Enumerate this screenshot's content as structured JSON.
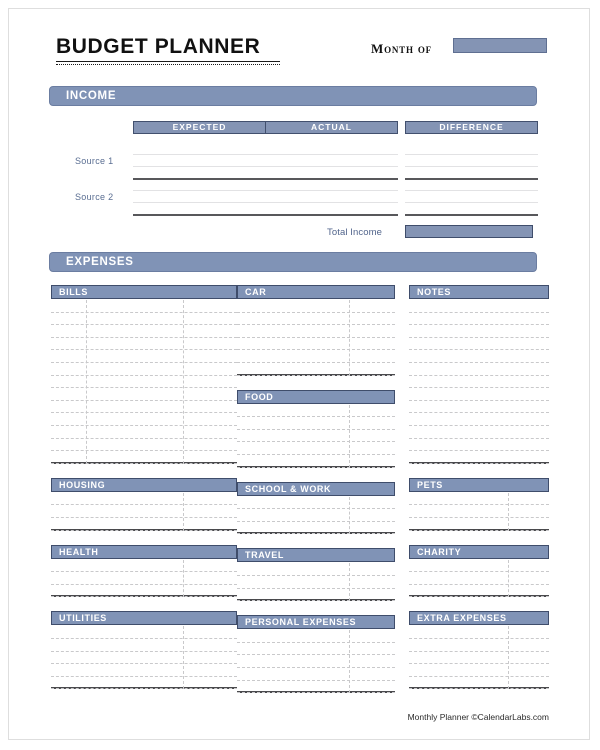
{
  "document": {
    "title": "BUDGET PLANNER",
    "month_label": "Month of",
    "month_value": ""
  },
  "income": {
    "banner": "INCOME",
    "columns": [
      "EXPECTED",
      "ACTUAL",
      "DIFFERENCE"
    ],
    "rows": [
      {
        "label": "Source 1"
      },
      {
        "label": "Source 2"
      }
    ],
    "total_label": "Total Income",
    "total_value": ""
  },
  "expenses": {
    "banner": "EXPENSES",
    "blocks": [
      {
        "title": "BILLS",
        "column": 0,
        "rows": 13,
        "dividers": 2
      },
      {
        "title": "HOUSING",
        "column": 0,
        "rows": 3,
        "dividers": 1
      },
      {
        "title": "HEALTH",
        "column": 0,
        "rows": 3,
        "dividers": 1
      },
      {
        "title": "UTILITIES",
        "column": 0,
        "rows": 5,
        "dividers": 1
      },
      {
        "title": "CAR",
        "column": 1,
        "rows": 6,
        "dividers": 1
      },
      {
        "title": "FOOD",
        "column": 1,
        "rows": 5,
        "dividers": 1
      },
      {
        "title": "SCHOOL & WORK",
        "column": 1,
        "rows": 3,
        "dividers": 1
      },
      {
        "title": "TRAVEL",
        "column": 1,
        "rows": 3,
        "dividers": 1
      },
      {
        "title": "PERSONAL EXPENSES",
        "column": 1,
        "rows": 5,
        "dividers": 1
      },
      {
        "title": "NOTES",
        "column": 2,
        "rows": 13,
        "dividers": 0
      },
      {
        "title": "PETS",
        "column": 2,
        "rows": 3,
        "dividers": 1
      },
      {
        "title": "CHARITY",
        "column": 2,
        "rows": 3,
        "dividers": 1
      },
      {
        "title": "EXTRA  EXPENSES",
        "column": 2,
        "rows": 5,
        "dividers": 1
      }
    ]
  },
  "footer": {
    "text": "Monthly Planner ©CalendarLabs.com"
  },
  "theme": {
    "banner_fill": "#8093b6",
    "banner_border": "#6b7da1",
    "header_fill": "#8494b4",
    "header_border": "#3f4d6b",
    "rule_dark": "#4a4a4d",
    "rule_light": "#c9c9cb",
    "label_blue": "#52658c"
  }
}
